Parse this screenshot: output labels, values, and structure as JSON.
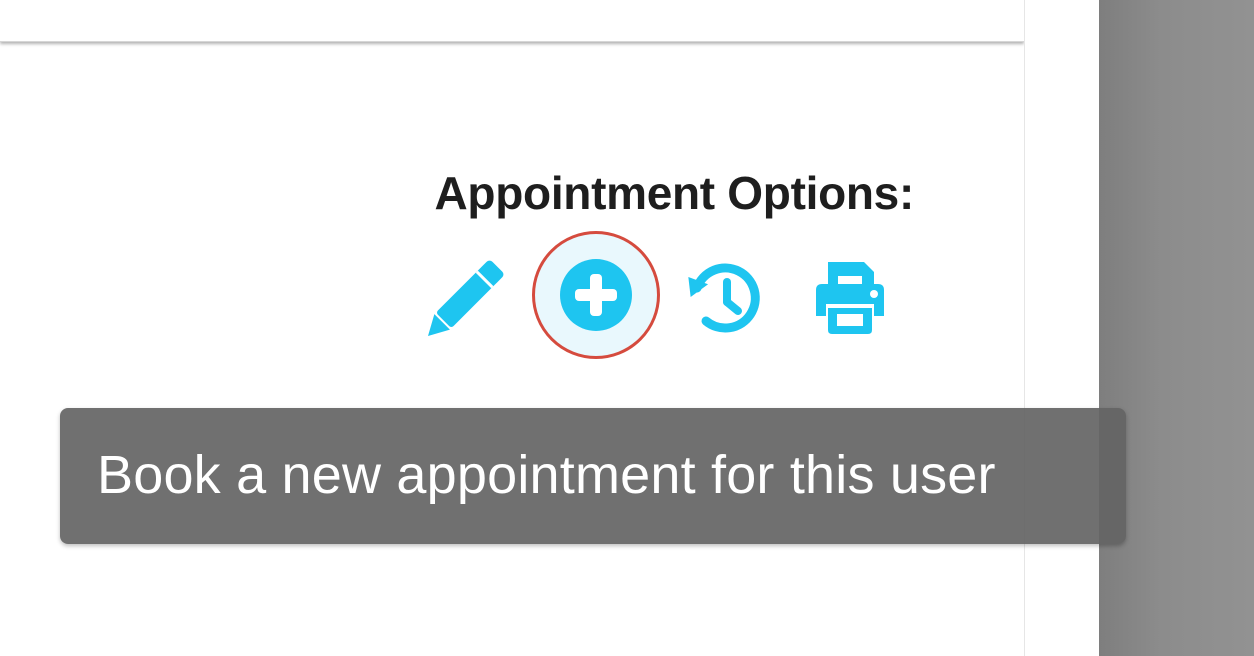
{
  "appointment_options": {
    "title": "Appointment Options:",
    "buttons": [
      {
        "id": "edit",
        "icon": "pencil-icon",
        "highlighted": false
      },
      {
        "id": "add",
        "icon": "plus-circle-icon",
        "highlighted": true
      },
      {
        "id": "history",
        "icon": "history-icon",
        "highlighted": false
      },
      {
        "id": "print",
        "icon": "printer-icon",
        "highlighted": false
      }
    ]
  },
  "tooltip": {
    "text": "Book a new appointment for this user"
  },
  "colors": {
    "icon": "#1ec5f0",
    "highlight_ring": "#d54b3e",
    "highlight_fill": "#e9f8fd",
    "tooltip_bg": "#646464",
    "side_panel": "#8c8c8c",
    "title_text": "#1e1e1e"
  }
}
